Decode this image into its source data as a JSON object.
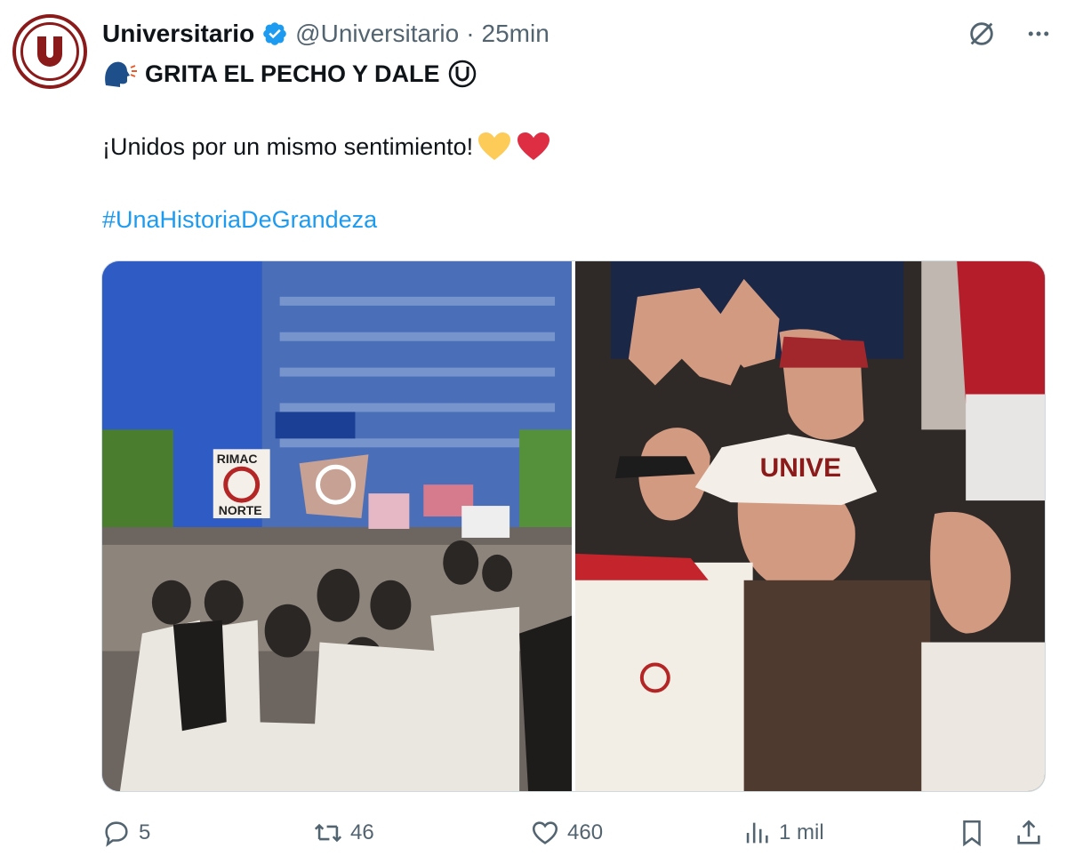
{
  "tweet": {
    "author_name": "Universitario",
    "handle": "@Universitario",
    "separator": "·",
    "time": "25min",
    "line1_text": "GRITA EL PECHO Y DALE",
    "line2_text": "¡Unidos por un mismo sentimiento!",
    "hashtag": "#UnaHistoriaDeGrandeza"
  },
  "photos": {
    "left_signs": [
      "RIMAC",
      "NORTE"
    ],
    "right_sign": "UNIVE"
  },
  "actions": {
    "replies": "5",
    "retweets": "46",
    "likes": "460",
    "views": "1 mil"
  },
  "colors": {
    "brand": "#8b1a1a",
    "link": "#1d9bf0",
    "verified": "#1d9bf0",
    "muted": "#536471"
  },
  "icons": [
    "avatar-logo",
    "verified-badge-icon",
    "grok-icon",
    "more-icon",
    "speaking-head-icon",
    "circled-u-icon",
    "yellow-heart-icon",
    "red-heart-icon",
    "reply-icon",
    "retweet-icon",
    "like-icon",
    "views-icon",
    "bookmark-icon",
    "share-icon"
  ]
}
